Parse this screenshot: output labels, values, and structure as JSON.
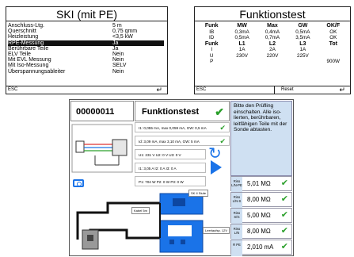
{
  "ski": {
    "title": "SKI (mit PE)",
    "rows": [
      {
        "label": "Anschluss-Ltg.",
        "value": "5 m"
      },
      {
        "label": "Querschnitt",
        "value": "0,75 qmm"
      },
      {
        "label": "Heizleistung",
        "value": "<3,5 kW"
      },
      {
        "label": "RPE-Messung",
        "value": "Ja",
        "selected": true
      },
      {
        "label": "Berührbare Teile",
        "value": "Ja"
      },
      {
        "label": "ELV Teile",
        "value": "Nein"
      },
      {
        "label": "Mit EVL Messung",
        "value": "Nein"
      },
      {
        "label": "Mit Iso-Messung",
        "value": "SELV"
      },
      {
        "label": "Überspannungsableiter",
        "value": "Nein"
      }
    ],
    "footer_left": "ESC",
    "footer_icon": "return-icon"
  },
  "funktionstest": {
    "title": "Funktionstest",
    "rows": [
      [
        "Funk",
        "MW",
        "Max",
        "GW",
        "OK/F"
      ],
      [
        "IB",
        "0,3mA",
        "0,4mA",
        "0,5mA",
        "OK"
      ],
      [
        "ID",
        "0,5mA",
        "0,7mA",
        "3,5mA",
        "OK"
      ],
      [
        "Funk",
        "L1",
        "L2",
        "L3",
        "Tot"
      ],
      [
        "I",
        "1A",
        "2A",
        "1A",
        ""
      ],
      [
        "U",
        "230V",
        "220V",
        "225V",
        ""
      ],
      [
        "P",
        "",
        "",
        "",
        "900W"
      ]
    ],
    "footer_left": "ESC",
    "footer_mid": "Reset",
    "footer_icon": "return-icon"
  },
  "device": {
    "id": "00000011",
    "title": "Funktionstest",
    "info": "Bitte den Prüfling einschalten. Alle iso-lierten, berührbaren, leitfähigen Teile mit der Sonde abtasten.",
    "measurements": [
      "I1: 0,055 mA, max 0,059 mA, GW: 0,5 mA",
      "Id: 3,09 mA, max 3,10 mA, GW: 5 mA",
      "U1: 231 V  U2: 0 V  U3: 0 V",
      "I1: 3,05 A  I2: 0 A  I3: 0 A",
      "P1: 704 W  P2: 0 W  P3: 0 W"
    ],
    "results": [
      {
        "label": "Riso L/N-PE",
        "value": "5,01 MΩ"
      },
      {
        "label": "Riso L/N-S",
        "value": "8,00 MΩ"
      },
      {
        "label": "Riso S/G",
        "value": "5,00 MΩ"
      },
      {
        "label": "Riso L/N",
        "value": "8,00 MΩ"
      },
      {
        "label": "R PE",
        "value": "2,010 mA"
      }
    ],
    "diagram_tags": [
      "Kabel 5m",
      "SK II Stufe",
      "Leerlaufsp. 12V"
    ],
    "accent": "#1a73e8",
    "ok_color": "#2ca02c",
    "info_bg": "#cfe0f2"
  }
}
